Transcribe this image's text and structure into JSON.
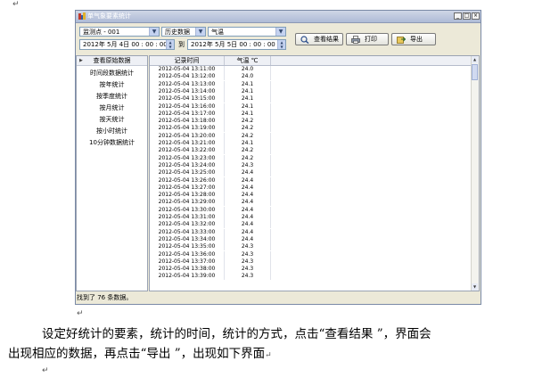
{
  "doc": {
    "para_mark": "↵"
  },
  "window": {
    "title": "单气象要素统计",
    "controls": {
      "minimize": "_",
      "maximize": "□",
      "close": "×"
    }
  },
  "toolbar": {
    "station": "监测点 - 001",
    "data_type": "历史数据",
    "element": "气温",
    "start": "2012年 5月 4日  00 : 00 : 00",
    "to": "到",
    "end": "2012年 5月 5日  00 : 00 : 00",
    "view_button": "查看结果",
    "print_button": "打印",
    "export_button": "导出"
  },
  "sidebar": {
    "header": "查看原始数据",
    "items": [
      {
        "label": "时间段数据统计"
      },
      {
        "label": "按年统计"
      },
      {
        "label": "按季度统计"
      },
      {
        "label": "按月统计"
      },
      {
        "label": "按天统计"
      },
      {
        "label": "按小时统计"
      },
      {
        "label": "10分钟数据统计"
      }
    ]
  },
  "table": {
    "columns": [
      "记录时间",
      "气温 ℃"
    ],
    "rows": [
      [
        "2012-05-04 13:11:00",
        "24.0"
      ],
      [
        "2012-05-04 13:12:00",
        "24.0"
      ],
      [
        "2012-05-04 13:13:00",
        "24.1"
      ],
      [
        "2012-05-04 13:14:00",
        "24.1"
      ],
      [
        "2012-05-04 13:15:00",
        "24.1"
      ],
      [
        "2012-05-04 13:16:00",
        "24.1"
      ],
      [
        "2012-05-04 13:17:00",
        "24.1"
      ],
      [
        "2012-05-04 13:18:00",
        "24.2"
      ],
      [
        "2012-05-04 13:19:00",
        "24.2"
      ],
      [
        "2012-05-04 13:20:00",
        "24.2"
      ],
      [
        "2012-05-04 13:21:00",
        "24.1"
      ],
      [
        "2012-05-04 13:22:00",
        "24.2"
      ],
      [
        "2012-05-04 13:23:00",
        "24.2"
      ],
      [
        "2012-05-04 13:24:00",
        "24.3"
      ],
      [
        "2012-05-04 13:25:00",
        "24.4"
      ],
      [
        "2012-05-04 13:26:00",
        "24.4"
      ],
      [
        "2012-05-04 13:27:00",
        "24.4"
      ],
      [
        "2012-05-04 13:28:00",
        "24.4"
      ],
      [
        "2012-05-04 13:29:00",
        "24.4"
      ],
      [
        "2012-05-04 13:30:00",
        "24.4"
      ],
      [
        "2012-05-04 13:31:00",
        "24.4"
      ],
      [
        "2012-05-04 13:32:00",
        "24.4"
      ],
      [
        "2012-05-04 13:33:00",
        "24.4"
      ],
      [
        "2012-05-04 13:34:00",
        "24.4"
      ],
      [
        "2012-05-04 13:35:00",
        "24.3"
      ],
      [
        "2012-05-04 13:36:00",
        "24.3"
      ],
      [
        "2012-05-04 13:37:00",
        "24.3"
      ],
      [
        "2012-05-04 13:38:00",
        "24.3"
      ],
      [
        "2012-05-04 13:39:00",
        "24.3"
      ]
    ]
  },
  "status": {
    "text": "找到了 76 条数据。"
  },
  "caption": {
    "line1": "设定好统计的要素，统计的时间，统计的方式，点击“查看结果 ”，界面会",
    "line2": "出现相应的数据，再点击“导出 ”，出现如下界面"
  },
  "colors": {
    "titlebar": "#aebbd6",
    "window_bg": "#ece9d8",
    "accent": "#7f9db9"
  }
}
